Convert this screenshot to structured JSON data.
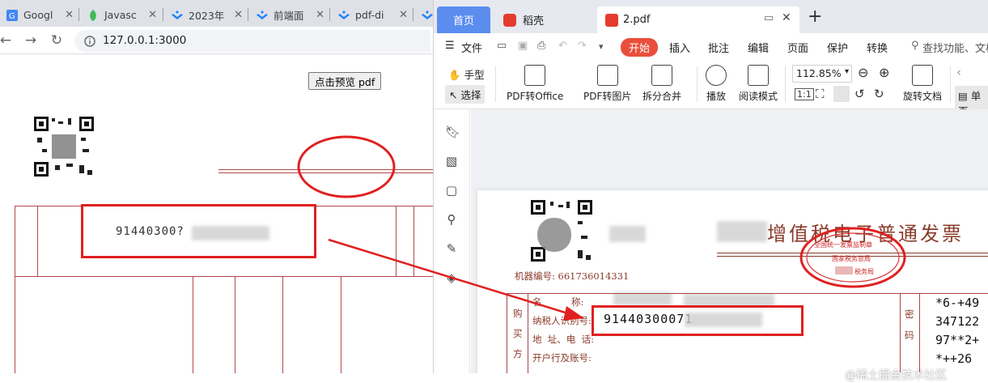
{
  "browser": {
    "tabs": [
      {
        "label": "Googl",
        "icon": "google-icon",
        "color": "#4285f4"
      },
      {
        "label": "Javasc",
        "icon": "leaf-icon",
        "color": "#3cba54"
      },
      {
        "label": "2023年",
        "icon": "juejin-icon",
        "color": "#1e80ff"
      },
      {
        "label": "前端面",
        "icon": "juejin-icon",
        "color": "#1e80ff"
      },
      {
        "label": "pdf-di",
        "icon": "juejin-icon",
        "color": "#1e80ff"
      }
    ],
    "url": "127.0.0.1:3000"
  },
  "page": {
    "preview_button": "点击预览 pdf",
    "tax_id_visible": "91440300?"
  },
  "wps": {
    "tabs": {
      "home": "首页",
      "shell": "稻壳",
      "doc": "2.pdf"
    },
    "menu": [
      "文件",
      "开始",
      "插入",
      "批注",
      "编辑",
      "页面",
      "保护",
      "转换"
    ],
    "search_placeholder": "查找功能、文档",
    "ribbon": {
      "hand": "手型",
      "select": "选择",
      "pdf_to_office": "PDF转Office",
      "pdf_to_image": "PDF转图片",
      "split_merge": "拆分合并",
      "play": "播放",
      "read_mode": "阅读模式",
      "zoom": "112.85%",
      "rotate": "旋转文档",
      "single_page": "单页"
    },
    "invoice": {
      "title": "增值税电子普通发票",
      "machine_label": "机器编号:",
      "machine_no": "661736014331",
      "buyer": "购买方",
      "name_label": "名          称:",
      "taxid_label": "纳税人识别号:",
      "address_label": "地  址、电  话:",
      "bank_label": "开户行及账号:",
      "taxid_value": "91440300071",
      "secret": "密码",
      "codes": [
        "*6-+49",
        "347122",
        "97**2+",
        "*++26"
      ],
      "seal_top": "全国统一发票监制章",
      "seal_mid": "国家税务总局",
      "seal_bottom": "税务局"
    }
  },
  "watermark": "@稀土掘金技术社区"
}
